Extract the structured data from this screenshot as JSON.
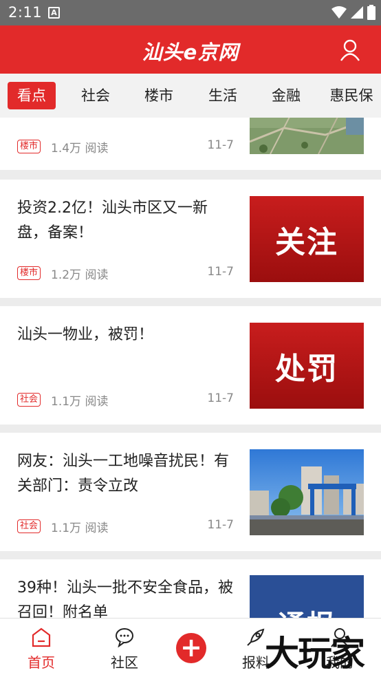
{
  "status_bar": {
    "time": "2:11",
    "notif_glyph": "A"
  },
  "header": {
    "logo": "汕头e京网",
    "user_icon": "user-icon"
  },
  "tabs": [
    {
      "label": "看点",
      "active": true
    },
    {
      "label": "社会",
      "active": false
    },
    {
      "label": "楼市",
      "active": false
    },
    {
      "label": "生活",
      "active": false
    },
    {
      "label": "金融",
      "active": false
    },
    {
      "label": "惠民保",
      "active": false
    }
  ],
  "feed": [
    {
      "title": "",
      "tag": "楼市",
      "reads": "1.4万 阅读",
      "date": "11-7",
      "thumb_type": "aerial-photo",
      "thumb_text": ""
    },
    {
      "title": "投资2.2亿！汕头市区又一新盘，备案！",
      "tag": "楼市",
      "reads": "1.2万 阅读",
      "date": "11-7",
      "thumb_type": "red-banner",
      "thumb_text": "关注"
    },
    {
      "title": "汕头一物业，被罚！",
      "tag": "社会",
      "reads": "1.1万 阅读",
      "date": "11-7",
      "thumb_type": "red-banner",
      "thumb_text": "处罚"
    },
    {
      "title": "网友：汕头一工地噪音扰民！有关部门：责令立改",
      "tag": "社会",
      "reads": "1.1万 阅读",
      "date": "11-7",
      "thumb_type": "construction-photo",
      "thumb_text": ""
    },
    {
      "title": "39种！汕头一批不安全食品，被召回！附名单",
      "tag": "",
      "reads": "",
      "date": "",
      "thumb_type": "blue-banner",
      "thumb_text": "通报"
    }
  ],
  "bottom_nav": [
    {
      "label": "首页",
      "icon": "home-icon",
      "active": true
    },
    {
      "label": "社区",
      "icon": "chat-bubble-icon",
      "active": false
    },
    {
      "label": "",
      "icon": "plus-icon",
      "active": false
    },
    {
      "label": "报料",
      "icon": "rocket-icon",
      "active": false
    },
    {
      "label": "我的",
      "icon": "user-icon",
      "active": false
    }
  ],
  "watermark": "大玩家",
  "colors": {
    "brand_red": "#e22a2a",
    "status_bar": "#6b6b6b",
    "tab_bg": "#f2f2f2",
    "meta_gray": "#888888"
  }
}
